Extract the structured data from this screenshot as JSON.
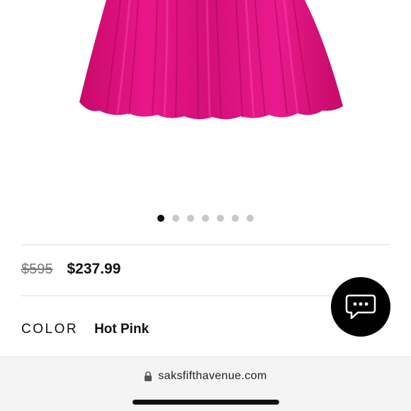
{
  "product": {
    "image_icon": "pink-pleated-skirt-photo",
    "color_accent": "#e0147e",
    "carousel": {
      "count": 7,
      "active_index": 0
    },
    "price": {
      "original": "$595",
      "sale": "$237.99"
    },
    "color": {
      "label": "COLOR",
      "value": "Hot Pink"
    }
  },
  "chat": {
    "icon": "chat-bubble-icon"
  },
  "browser": {
    "icon": "lock-icon",
    "url": "saksfifthavenue.com"
  }
}
